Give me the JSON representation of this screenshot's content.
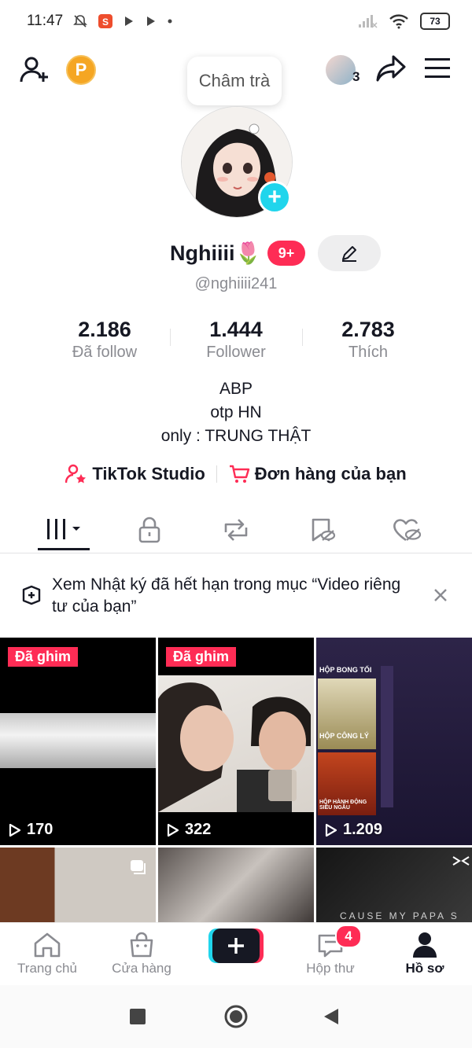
{
  "status_bar": {
    "time": "11:47",
    "battery": "73"
  },
  "header": {
    "coin_label": "P",
    "status_bubble": "Châm trà",
    "friends_count": "3"
  },
  "profile": {
    "display_name": "Nghiiii🌷",
    "badge": "9+",
    "handle": "@nghiiii241",
    "stats": [
      {
        "value": "2.186",
        "label": "Đã follow"
      },
      {
        "value": "1.444",
        "label": "Follower"
      },
      {
        "value": "2.783",
        "label": "Thích"
      }
    ],
    "bio": [
      "ABP",
      "otp HN",
      "only : TRUNG THẬT"
    ],
    "links": {
      "studio": "TikTok Studio",
      "orders": "Đơn hàng của bạn"
    }
  },
  "tabs": [
    "videos-tab",
    "private-tab",
    "reposts-tab",
    "favorites-tab",
    "liked-tab"
  ],
  "notice": {
    "text": "Xem Nhật ký đã hết hạn trong mục “Video riêng tư của bạn”"
  },
  "videos": [
    {
      "pinned_label": "Đã ghim",
      "views": "170"
    },
    {
      "pinned_label": "Đã ghim",
      "views": "322"
    },
    {
      "pinned_label": "",
      "views": "1.209"
    },
    {
      "pinned_label": "",
      "views": ""
    },
    {
      "pinned_label": "",
      "views": ""
    },
    {
      "pinned_label": "",
      "views": ""
    }
  ],
  "grid_overlay_texts": {
    "game_title": "HỘP BONG TỐI",
    "game_box1": "HỘP CÔNG LÝ",
    "game_box2": "HỘP HÀNH ĐỘNG SIÊU NGẦU",
    "caption": "CAUSE MY PAPA S"
  },
  "bottom_nav": {
    "home": "Trang chủ",
    "shop": "Cửa hàng",
    "inbox": "Hộp thư",
    "inbox_badge": "4",
    "profile": "Hồ sơ"
  },
  "colors": {
    "accent": "#fe2c55",
    "cyan": "#20d5ec",
    "text": "#161823",
    "muted": "#8a8b91"
  }
}
